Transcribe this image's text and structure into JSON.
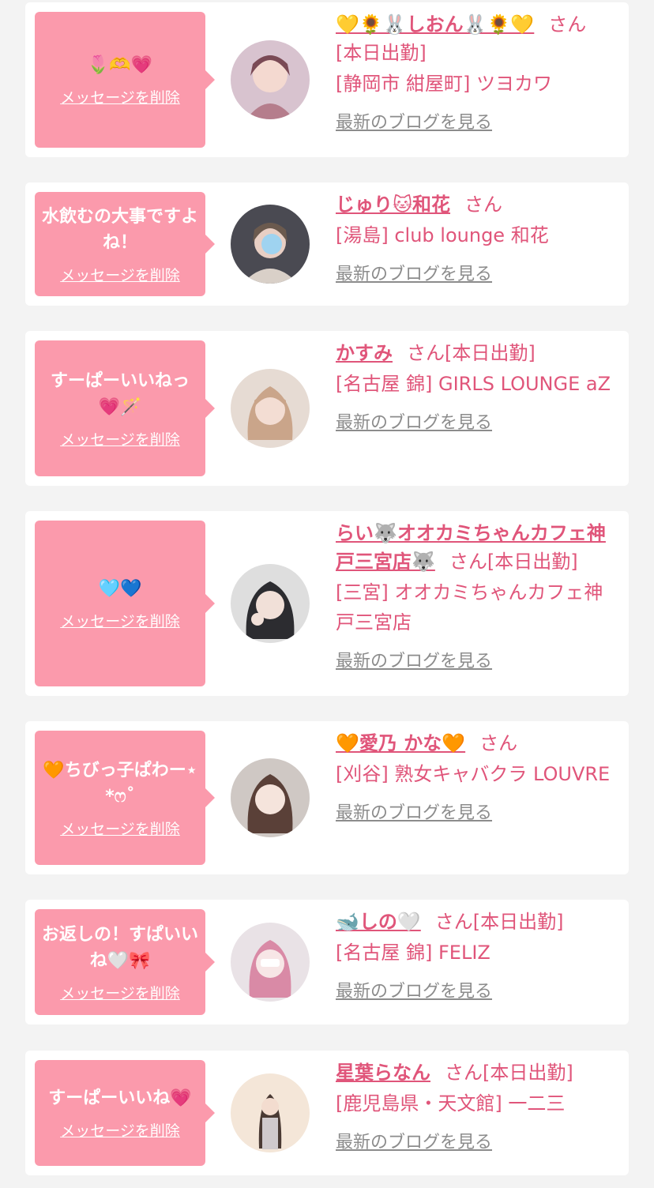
{
  "delete_label": "メッセージを削除",
  "blog_label": "最新のブログを見る",
  "san_label": "さん",
  "today_label": "[本日出勤]",
  "colors": {
    "bubble": "#fb9aac",
    "accent": "#e0557a",
    "link_gray": "#8c8c8c",
    "background": "#f3f3f3"
  },
  "cards": [
    {
      "message": "🌷🫶💗",
      "name": "💛🌻🐰しおん🐰🌻💛",
      "today": "[本日出勤]",
      "shop": "[静岡市 紺屋町] ツヨカワ"
    },
    {
      "message": "水飲むの大事ですよね！",
      "name": "じゅり🐱和花",
      "today": "",
      "shop": "[湯島] club lounge 和花"
    },
    {
      "message": "すーぱーいいねっ💗🪄",
      "name": "かすみ",
      "today": "[本日出勤]",
      "shop": "[名古屋 錦] GIRLS LOUNGE aZ"
    },
    {
      "message": "🩵💙",
      "name": "らい🐺オオカミちゃんカフェ神戸三宮店🐺",
      "today": "[本日出勤]",
      "shop": "[三宮] オオカミちゃんカフェ神戸三宮店"
    },
    {
      "message": "🧡ちびっ子ぱわー⋆*ෆ˚",
      "name": "🧡愛乃 かな🧡",
      "today": "",
      "shop": "[刈谷] 熟女キャバクラ LOUVRE"
    },
    {
      "message": "お返しの！すぱいいね🤍🎀",
      "name": "🐋しの🤍",
      "today": "[本日出勤]",
      "shop": "[名古屋 錦] FELIZ"
    },
    {
      "message": "すーぱーいいね💗",
      "name": "星葉らなん",
      "today": "[本日出勤]",
      "shop": "[鹿児島県・天文館] 一二三"
    }
  ]
}
